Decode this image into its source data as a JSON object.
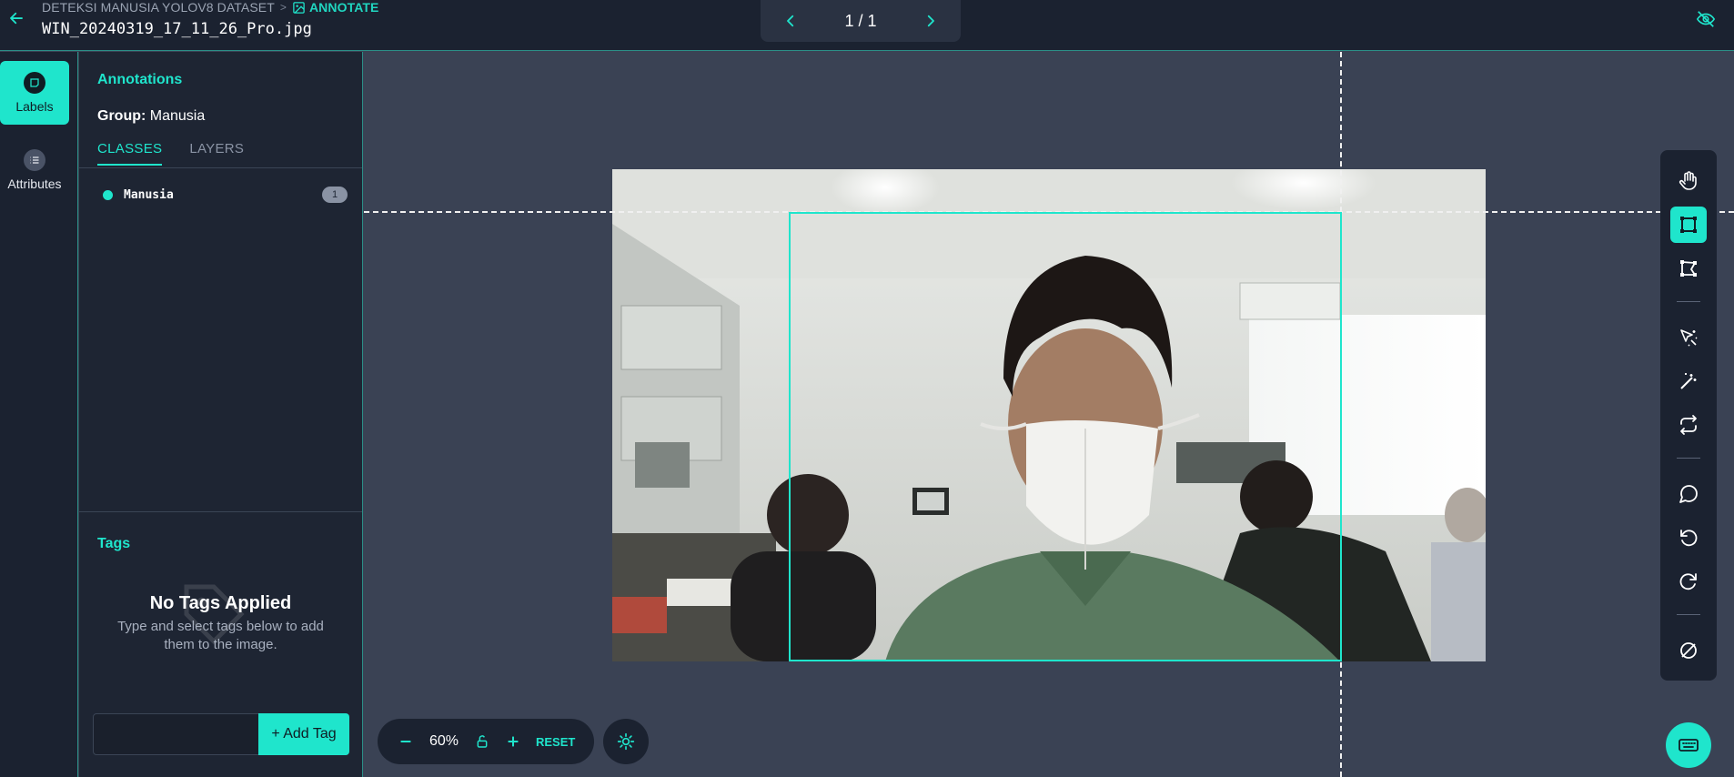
{
  "header": {
    "breadcrumb_dataset": "DETEKSI MANUSIA YOLOV8 DATASET",
    "breadcrumb_sep": ">",
    "breadcrumb_active": "ANNOTATE",
    "filename": "WIN_20240319_17_11_26_Pro.jpg",
    "pager": "1 / 1"
  },
  "nav": {
    "labels": "Labels",
    "attributes": "Attributes"
  },
  "panel": {
    "title": "Annotations",
    "group_label": "Group:",
    "group_value": "Manusia",
    "tabs": [
      "CLASSES",
      "LAYERS"
    ],
    "classes": [
      {
        "name": "Manusia",
        "count": "1",
        "color": "#1fe5cc"
      }
    ],
    "tags_title": "Tags",
    "no_tags_title": "No Tags Applied",
    "no_tags_desc": "Type and select tags below to add them to the image.",
    "tag_input_value": "",
    "add_tag_label": "+ Add Tag"
  },
  "zoom": {
    "value": "60%",
    "reset_label": "RESET"
  },
  "colors": {
    "accent": "#1fe5cc",
    "bg": "#3a4254",
    "panel": "#1e2533"
  },
  "toolbar_icons": [
    "hand-icon",
    "bounding-box-icon",
    "polygon-icon",
    "smart-select-icon",
    "magic-wand-icon",
    "repeat-icon",
    "comment-icon",
    "undo-icon",
    "redo-icon",
    "hide-annotations-icon"
  ]
}
